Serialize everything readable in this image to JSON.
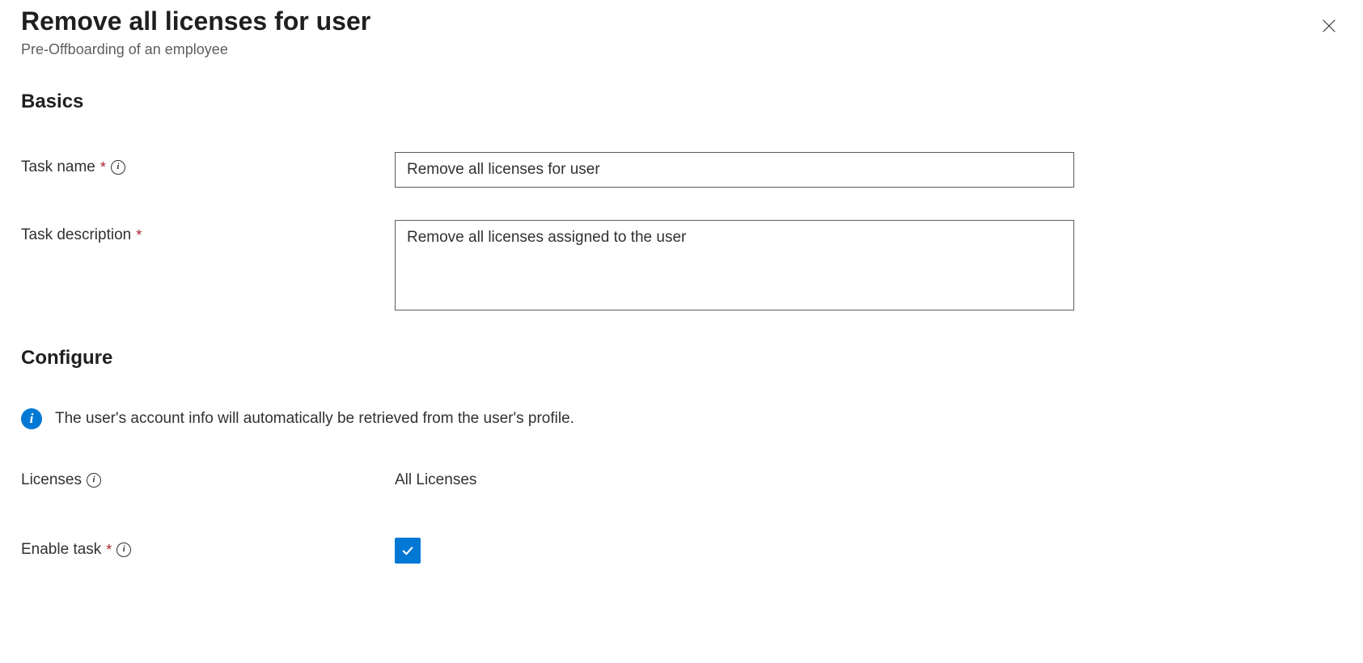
{
  "header": {
    "title": "Remove all licenses for user",
    "subtitle": "Pre-Offboarding of an employee"
  },
  "sections": {
    "basics": {
      "heading": "Basics",
      "task_name": {
        "label": "Task name",
        "value": "Remove all licenses for user"
      },
      "task_description": {
        "label": "Task description",
        "value": "Remove all licenses assigned to the user"
      }
    },
    "configure": {
      "heading": "Configure",
      "info_message": "The user's account info will automatically be retrieved from the user's profile.",
      "licenses": {
        "label": "Licenses",
        "value": "All Licenses"
      },
      "enable_task": {
        "label": "Enable task",
        "checked": true
      }
    }
  }
}
